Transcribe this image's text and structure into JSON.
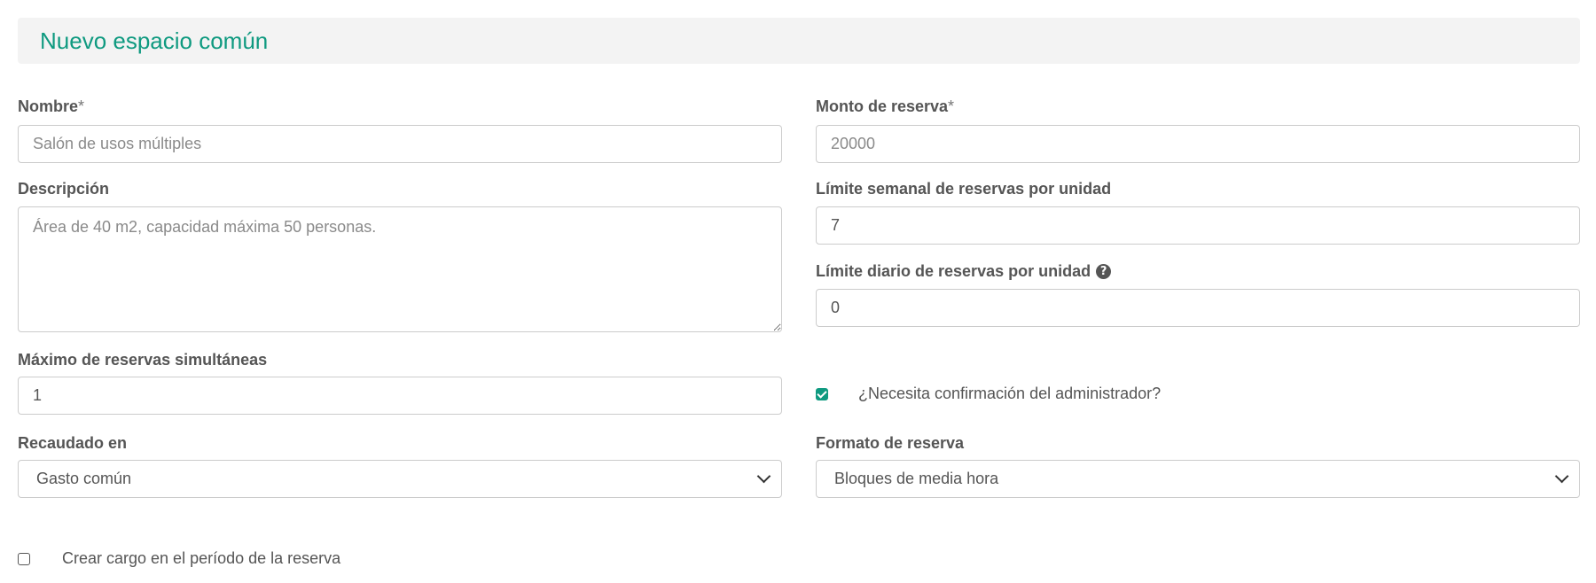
{
  "header": {
    "title": "Nuevo espacio común"
  },
  "fields": {
    "nombre": {
      "label": "Nombre",
      "required_mark": "*",
      "placeholder": "Salón de usos múltiples",
      "value": ""
    },
    "monto": {
      "label": "Monto de reserva",
      "required_mark": "*",
      "placeholder": "20000",
      "value": ""
    },
    "descripcion": {
      "label": "Descripción",
      "placeholder": "Área de 40 m2, capacidad máxima 50 personas.",
      "value": ""
    },
    "limite_semanal": {
      "label": "Límite semanal de reservas por unidad",
      "value": "7"
    },
    "limite_diario": {
      "label": "Límite diario de reservas por unidad",
      "help_icon": "?",
      "value": "0"
    },
    "maximo_simultaneas": {
      "label": "Máximo de reservas simultáneas",
      "value": "1"
    },
    "confirmacion": {
      "label": "¿Necesita confirmación del administrador?",
      "checked": true
    },
    "recaudado": {
      "label": "Recaudado en",
      "selected": "Gasto común"
    },
    "formato": {
      "label": "Formato de reserva",
      "selected": "Bloques de media hora"
    },
    "crear_cargo": {
      "label": "Crear cargo en el período de la reserva",
      "checked": false
    }
  },
  "colors": {
    "accent": "#0f9a80",
    "header_bg": "#f3f3f3",
    "text": "#555555",
    "border": "#cccccc"
  }
}
